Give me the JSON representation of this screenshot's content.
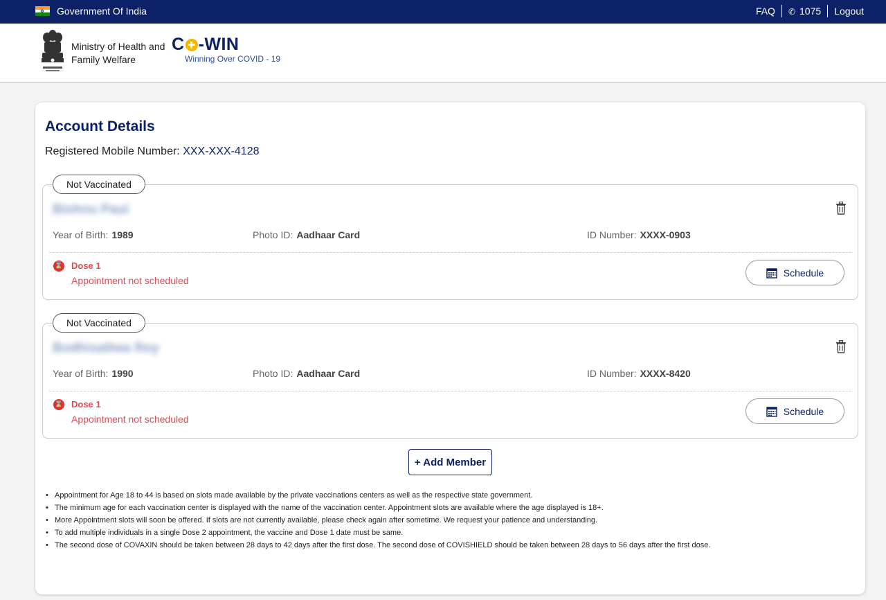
{
  "gov_bar": {
    "title": "Government Of India",
    "faq": "FAQ",
    "phone": "1075",
    "logout": "Logout"
  },
  "header": {
    "ministry_line1": "Ministry of Health and",
    "ministry_line2": "Family Welfare",
    "logo_prefix": "C",
    "logo_suffix": "-WIN",
    "tagline": "Winning Over COVID - 19"
  },
  "account": {
    "title": "Account Details",
    "mobile_label": "Registered Mobile Number:",
    "mobile_value": "XXX-XXX-4128"
  },
  "members": [
    {
      "status": "Not Vaccinated",
      "name": "Bishnu Paul",
      "yob_label": "Year of Birth:",
      "yob": "1989",
      "photo_id_label": "Photo ID:",
      "photo_id": "Aadhaar Card",
      "id_number_label": "ID Number:",
      "id_number": "XXXX-0903",
      "dose_label": "Dose 1",
      "dose_status": "Appointment not scheduled",
      "schedule_label": "Schedule"
    },
    {
      "status": "Not Vaccinated",
      "name": "Bodhisattwa Roy",
      "yob_label": "Year of Birth:",
      "yob": "1990",
      "photo_id_label": "Photo ID:",
      "photo_id": "Aadhaar Card",
      "id_number_label": "ID Number:",
      "id_number": "XXXX-8420",
      "dose_label": "Dose 1",
      "dose_status": "Appointment not scheduled",
      "schedule_label": "Schedule"
    }
  ],
  "add_member_label": "+ Add Member",
  "notes": [
    "Appointment for Age 18 to 44 is based on slots made available by the private vaccinations centers as well as the respective state government.",
    "The minimum age for each vaccination center is displayed with the name of the vaccination center. Appointment slots are available where the age displayed is 18+.",
    "More Appointment slots will soon be offered. If slots are not currently available, please check again after sometime. We request your patience and understanding.",
    "To add multiple individuals in a single Dose 2 appointment, the vaccine and Dose 1 date must be same.",
    "The second dose of COVAXIN should be taken between 28 days to 42 days after the first dose. The second dose of COVISHIELD should be taken between 28 days to 56 days after the first dose."
  ],
  "colors": {
    "navy": "#0c2168",
    "alert_red": "#e04a55",
    "logo_yellow": "#f7b500"
  },
  "icons": {
    "flag": "india-flag-icon",
    "phone": "phone-icon",
    "emblem": "national-emblem-icon",
    "trash": "trash-icon",
    "dose": "hourglass-icon",
    "calendar": "calendar-icon"
  }
}
